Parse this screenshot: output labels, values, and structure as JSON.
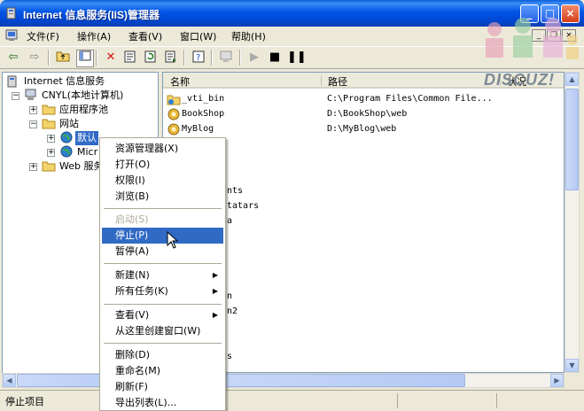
{
  "window": {
    "title": "Internet 信息服务(IIS)管理器"
  },
  "menubar": {
    "items": [
      "文件(F)",
      "操作(A)",
      "查看(V)",
      "窗口(W)",
      "帮助(H)"
    ]
  },
  "toolbar": {
    "icons": [
      "back-arrow-icon",
      "forward-arrow-icon",
      "up-folder-icon",
      "show-tree-icon",
      "delete-icon",
      "properties-icon",
      "refresh-icon",
      "export-list-icon",
      "help-icon",
      "computer-icon",
      "start-icon",
      "stop-icon",
      "pause-icon"
    ]
  },
  "tree": {
    "root": "Internet 信息服务",
    "computer": "CNYL(本地计算机)",
    "app_pools": "应用程序池",
    "websites": "网站",
    "default_site": "默认",
    "micro_site": "Micr",
    "web_ext": "Web 服务"
  },
  "list": {
    "columns": {
      "name": "名称",
      "path": "路径",
      "status": "状况"
    },
    "rows": [
      {
        "name": "_vti_bin",
        "path": "C:\\Program Files\\Common File..."
      },
      {
        "name": "BookShop",
        "path": "D:\\BookShop\\web"
      },
      {
        "name": "MyBlog",
        "path": "D:\\MyBlog\\web"
      }
    ],
    "partial_rows": [
      "nts",
      "tatars",
      "a",
      "n",
      "n2",
      "s"
    ]
  },
  "context_menu": {
    "items": [
      {
        "label": "资源管理器(X)"
      },
      {
        "label": "打开(O)"
      },
      {
        "label": "权限(I)"
      },
      {
        "label": "浏览(B)"
      },
      {
        "label": "启动(S)",
        "disabled": true
      },
      {
        "label": "停止(P)",
        "highlighted": true
      },
      {
        "label": "暂停(A)"
      },
      {
        "label": "新建(N)",
        "submenu": true
      },
      {
        "label": "所有任务(K)",
        "submenu": true
      },
      {
        "label": "查看(V)",
        "submenu": true
      },
      {
        "label": "从这里创建窗口(W)"
      },
      {
        "label": "删除(D)"
      },
      {
        "label": "重命名(M)"
      },
      {
        "label": "刷新(F)"
      },
      {
        "label": "导出列表(L)..."
      }
    ]
  },
  "status": {
    "text": "停止项目"
  },
  "watermark": {
    "text": "DISCUZ!"
  },
  "colors": {
    "selection": "#316ac5",
    "titlebar": "#0055e5",
    "face": "#ece9d8"
  }
}
